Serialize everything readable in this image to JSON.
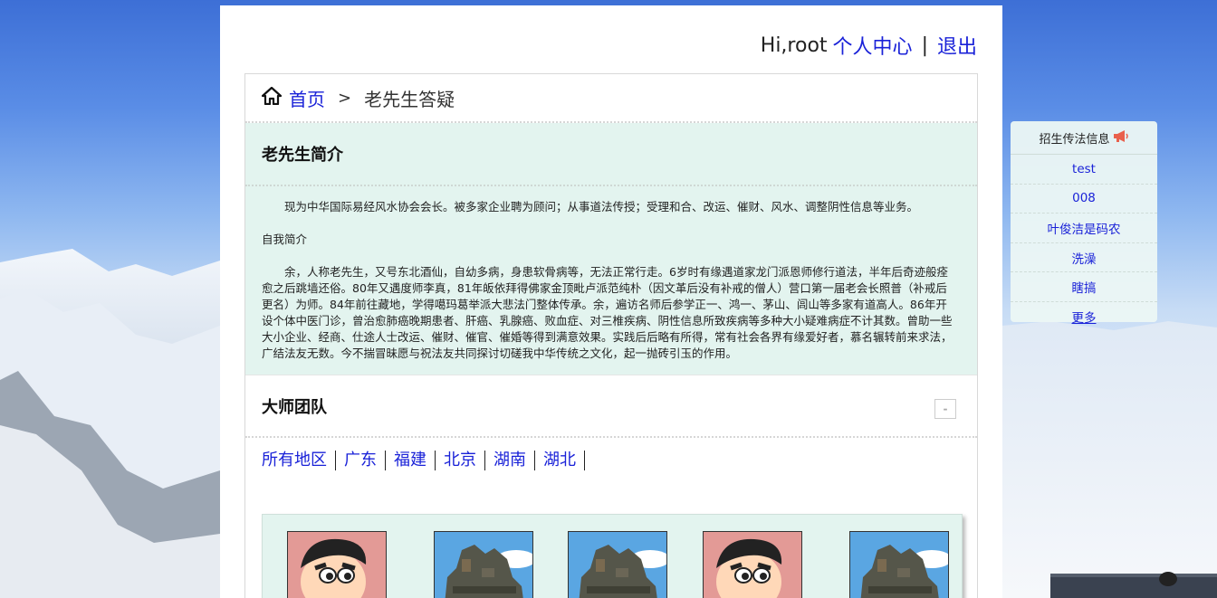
{
  "header": {
    "greeting": "Hi,root",
    "profile_link": "个人中心",
    "separator": "|",
    "logout_link": "退出"
  },
  "breadcrumb": {
    "home": "首页",
    "arrow": ">",
    "current": "老先生答疑"
  },
  "intro": {
    "title": "老先生简介",
    "para1": "现为中华国际易经风水协会会长。被多家企业聘为顾问；从事道法传授；受理和合、改运、催财、风水、调整阴性信息等业务。",
    "subtitle": "自我简介",
    "para2": "余，人称老先生，又号东北酒仙，自幼多病，身患软骨病等，无法正常行走。6岁时有缘遇道家龙门派恩师修行道法，半年后奇迹般痊愈之后跳墙还俗。80年又遇度师李真，81年皈依拜得佛家金顶毗卢派范纯朴（因文革后没有补戒的僧人）营口第一届老会长照普（补戒后更名）为师。84年前往藏地，学得噶玛葛举派大悲法门整体传承。余，遍访名师后参学正一、鸿一、茅山、闾山等多家有道高人。86年开设个体中医门诊，曾治愈肺癌晚期患者、肝癌、乳腺癌、败血症、对三椎疾病、阴性信息所致疾病等多种大小疑难病症不计其数。曾助一些大小企业、经商、仕途人士改运、催财、催官、催婚等得到满意效果。实践后后略有所得，常有社会各界有缘爱好者，慕名辗转前来求法，广结法友无数。今不揣冒昧愿与祝法友共同探讨切磋我中华传统之文化，起一抛砖引玉的作用。"
  },
  "team": {
    "title": "大师团队",
    "collapse_label": "-",
    "regions": [
      "所有地区",
      "广东",
      "福建",
      "北京",
      "湖南",
      "湖北"
    ],
    "cards": [
      {
        "image": "cartoon-boy"
      },
      {
        "image": "castle"
      },
      {
        "image": "castle"
      },
      {
        "image": "cartoon-boy"
      },
      {
        "image": "castle"
      }
    ]
  },
  "sidebar": {
    "title": "招生传法信息",
    "icon": "megaphone-icon",
    "items": [
      "test",
      "008",
      "叶俊洁是码农",
      "洗澡",
      "瞎搞"
    ],
    "more": "更多"
  },
  "colors": {
    "link": "#1a22d8",
    "panel_bg": "#e3f4ef",
    "megaphone": "#e9604c"
  }
}
